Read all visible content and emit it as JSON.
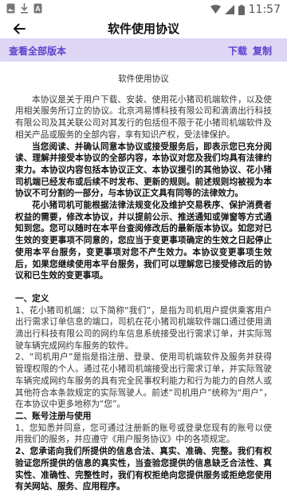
{
  "status_bar": {
    "time": "11:57"
  },
  "app_bar": {
    "title": "软件使用协议"
  },
  "action_bar": {
    "view_all": "查看全部版本",
    "download": "下载",
    "copy": "复制"
  },
  "doc": {
    "title": "软件使用协议",
    "intro": "本协议是关于用户下载、安装、使用花小猪司机端软件，以及使用相关服务所订立的协议。北京鸿易博科技有限公司和滴滴出行科技有限公司及其关联公司对其发行的包括但不限于花小猪司机端软件及相关产品或服务的全部内容，享有知识产权，受法律保护。",
    "notice1": "当您阅读、并确认同意本协议或接受服务后，即表示您已充分阅读、理解并接受本协议的全部内容，本协议对您及我们均具有法律约束力。本协议内容包括本协议正文、本协议援引的其他协议、花小猪司机端已经发布或后续不时发布、更新的规则。前述规则均被视为本协议不可分割的一部分，与本协议正文具有同等的法律效力。",
    "notice2": "花小猪司机可能根据法律法规变化及维护交易秩序、保护消费者权益的需要，修改本协议，并以提前公示、推送通知或弹窗等方式通知到您。您可以随时在本平台查阅修改后的最新版本协议。如您对已生效的变更事项不同意的，您应当于变更事项确定的生效之日起停止使用本平台服务，变更事项对您不产生效力。本协议变更事项生效后，如果您继续使用本平台服务，我们可以理解您已接受修改后的协议和已生效的变更事项。",
    "sec1": "一、定义",
    "s1_1": "1、花小猪司机端：以下简称“我们”，是指为司机用户提供乘客用户出行需求订单信息的端口，司机在花小猪司机端软件端口通过使用滴滴出行科技有限公司的网约车信息系统接受出行需求订单，并实际驾驶车辆完成网约车服务的软件。",
    "s1_2": "2、“司机用户”是指是指注册、登录、使用司机端软件及服务并获得管理权限的个人。通过花小猪司机端接受出行需求订单，并实际驾驶车辆完成网约车服务的具有完全民事权利能力和行为能力的自然人或其他符合本条款规定的实际驾驶人。前述“司机用户”统称为“用户”，在本协议中更多地称为“您”。",
    "sec2": "二、账号注册与使用",
    "s2_1": "1、您知悉并同意，您可通过注册新的账号或登录您现有的账号以使用我们的服务，并应遵守《用户服务协议》中的各项规定。",
    "s2_2": "2、您承诺向我们所提供的信息合法、真实、准确、完整。我们有权验证您所提供的信息的真实性，当查验您提供的信息缺乏合法性、真实性、准确性、完整性时，我们有权拒绝向您提供服务或拒绝您使用有关网站、服务、应用程序。"
  }
}
